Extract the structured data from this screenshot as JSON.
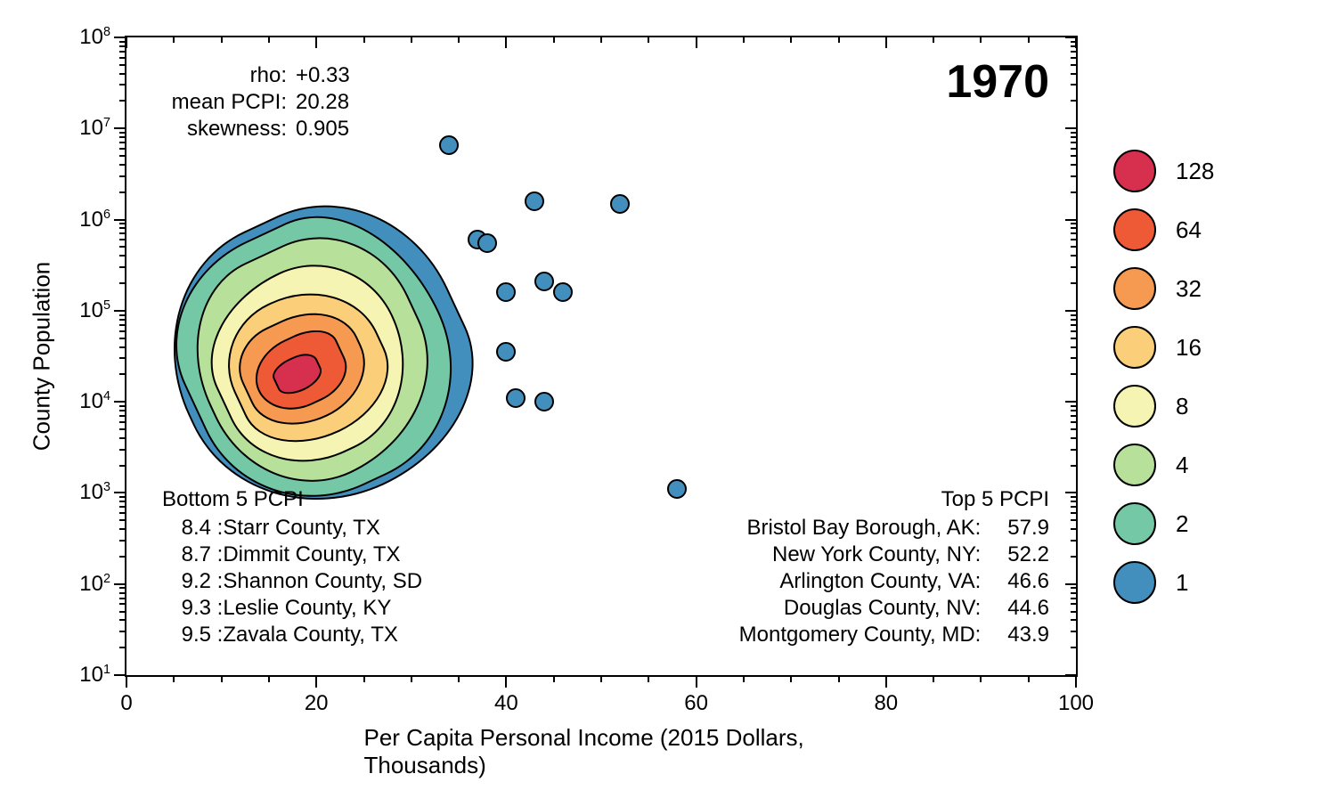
{
  "chart_data": {
    "type": "heatmap",
    "title": "",
    "year": "1970",
    "xlabel": "Per Capita Personal Income (2015 Dollars, Thousands)",
    "ylabel": "County Population",
    "xlim": [
      0,
      100
    ],
    "ylim_log10": [
      1,
      8
    ],
    "x_ticks": [
      0,
      20,
      40,
      60,
      80,
      100
    ],
    "y_ticks_exponents": [
      1,
      2,
      3,
      4,
      5,
      6,
      7,
      8
    ],
    "density_mode_x": 18,
    "density_mode_y": 20000,
    "stats": {
      "rho": "+0.33",
      "mean_PCPI": "20.28",
      "skewness": "0.905"
    },
    "legend_levels": [
      {
        "label": "128",
        "color": "#d7304f"
      },
      {
        "label": "64",
        "color": "#ee5a36"
      },
      {
        "label": "32",
        "color": "#f79a51"
      },
      {
        "label": "16",
        "color": "#fbcf79"
      },
      {
        "label": "8",
        "color": "#f6f4b2"
      },
      {
        "label": "4",
        "color": "#b7e09b"
      },
      {
        "label": "2",
        "color": "#74c8a5"
      },
      {
        "label": "1",
        "color": "#428fbd"
      }
    ],
    "bottom5": [
      {
        "value": "8.4",
        "name": "Starr County, TX"
      },
      {
        "value": "8.7",
        "name": "Dimmit County, TX"
      },
      {
        "value": "9.2",
        "name": "Shannon County, SD"
      },
      {
        "value": "9.3",
        "name": "Leslie County, KY"
      },
      {
        "value": "9.5",
        "name": "Zavala County, TX"
      }
    ],
    "top5": [
      {
        "name": "Bristol Bay Borough, AK",
        "value": "57.9"
      },
      {
        "name": "New York County, NY",
        "value": "52.2"
      },
      {
        "name": "Arlington County, VA",
        "value": "46.6"
      },
      {
        "name": "Douglas County, NV",
        "value": "44.6"
      },
      {
        "name": "Montgomery County, MD",
        "value": "43.9"
      }
    ],
    "outlier_points": [
      {
        "x": 34,
        "y": 6500000
      },
      {
        "x": 37,
        "y": 600000
      },
      {
        "x": 38,
        "y": 550000
      },
      {
        "x": 40,
        "y": 160000
      },
      {
        "x": 40,
        "y": 35000
      },
      {
        "x": 41,
        "y": 11000
      },
      {
        "x": 43,
        "y": 1600000
      },
      {
        "x": 44,
        "y": 210000
      },
      {
        "x": 44,
        "y": 10000
      },
      {
        "x": 46,
        "y": 160000
      },
      {
        "x": 52,
        "y": 1500000
      },
      {
        "x": 58,
        "y": 1100
      }
    ]
  },
  "labels": {
    "bottom5_header": "Bottom 5 PCPI",
    "top5_header": "Top 5 PCPI",
    "rho_key": "rho:",
    "mean_key": "mean PCPI:",
    "skew_key": "skewness:"
  }
}
